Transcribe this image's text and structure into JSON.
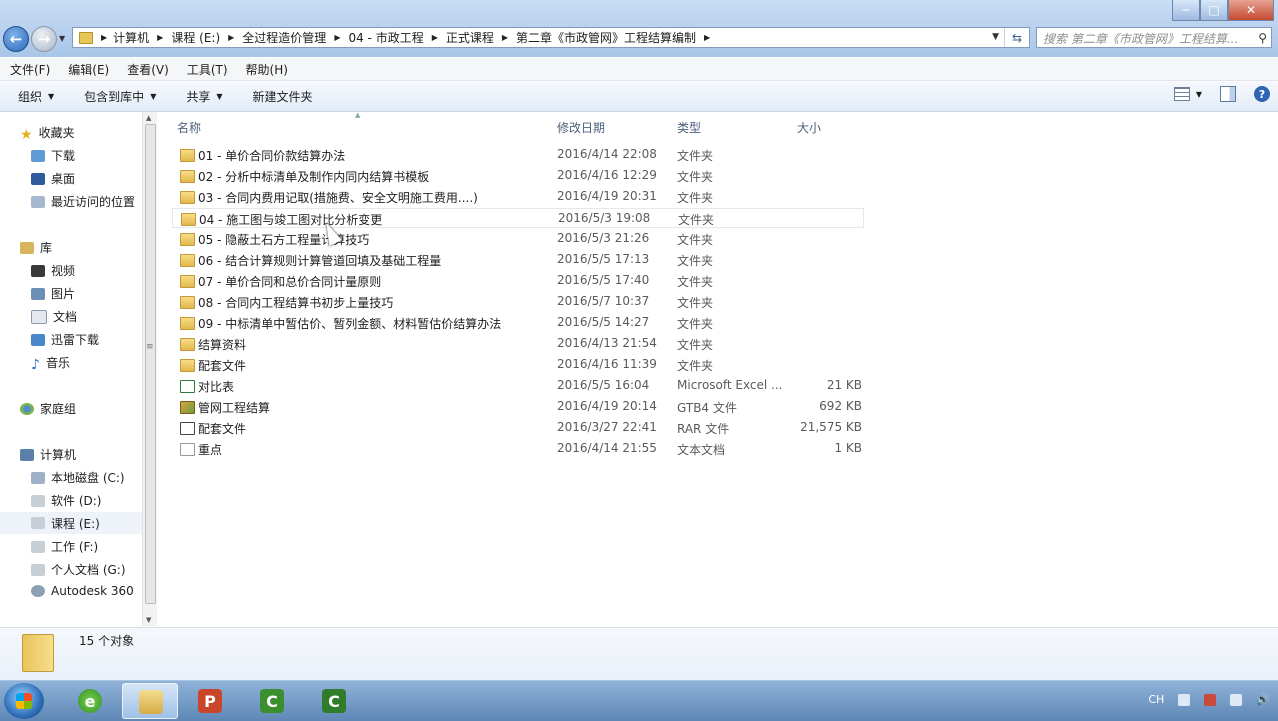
{
  "window": {
    "minimize": "─",
    "maximize": "□",
    "close": "✕"
  },
  "nav": {
    "back": "←",
    "forward": "→"
  },
  "address": {
    "crumbs": [
      "计算机",
      "课程 (E:)",
      "全过程造价管理",
      "04 - 市政工程",
      "正式课程",
      "第二章《市政管网》工程结算编制"
    ]
  },
  "search": {
    "placeholder": "搜索 第二章《市政管网》工程结算..."
  },
  "menu": [
    "文件(F)",
    "编辑(E)",
    "查看(V)",
    "工具(T)",
    "帮助(H)"
  ],
  "commands": {
    "organize": "组织",
    "include": "包含到库中",
    "share": "共享",
    "new_folder": "新建文件夹",
    "help": "?"
  },
  "sidebar": {
    "favorites": {
      "label": "收藏夹",
      "items": [
        "下载",
        "桌面",
        "最近访问的位置"
      ]
    },
    "libraries": {
      "label": "库",
      "items": [
        "视频",
        "图片",
        "文档",
        "迅雷下载",
        "音乐"
      ]
    },
    "homegroup": {
      "label": "家庭组"
    },
    "computer": {
      "label": "计算机",
      "items": [
        "本地磁盘 (C:)",
        "软件 (D:)",
        "课程 (E:)",
        "工作 (F:)",
        "个人文档 (G:)",
        "Autodesk 360"
      ]
    }
  },
  "columns": {
    "name": "名称",
    "date": "修改日期",
    "type": "类型",
    "size": "大小"
  },
  "files": [
    {
      "name": "01 - 单价合同价款结算办法",
      "date": "2016/4/14 22:08",
      "type": "文件夹",
      "size": "",
      "icon": "folder-icon"
    },
    {
      "name": "02 - 分析中标清单及制作内同内结算书模板",
      "date": "2016/4/16 12:29",
      "type": "文件夹",
      "size": "",
      "icon": "folder-icon"
    },
    {
      "name": "03 - 合同内费用记取(措施费、安全文明施工费用....)",
      "date": "2016/4/19 20:31",
      "type": "文件夹",
      "size": "",
      "icon": "folder-icon"
    },
    {
      "name": "04 - 施工图与竣工图对比分析变更",
      "date": "2016/5/3 19:08",
      "type": "文件夹",
      "size": "",
      "icon": "folder-icon"
    },
    {
      "name": "05 - 隐蔽土石方工程量计算技巧",
      "date": "2016/5/3 21:26",
      "type": "文件夹",
      "size": "",
      "icon": "folder-icon"
    },
    {
      "name": "06 - 结合计算规则计算管道回填及基础工程量",
      "date": "2016/5/5 17:13",
      "type": "文件夹",
      "size": "",
      "icon": "folder-icon"
    },
    {
      "name": "07 - 单价合同和总价合同计量原则",
      "date": "2016/5/5 17:40",
      "type": "文件夹",
      "size": "",
      "icon": "folder-icon"
    },
    {
      "name": "08 - 合同内工程结算书初步上量技巧",
      "date": "2016/5/7 10:37",
      "type": "文件夹",
      "size": "",
      "icon": "folder-icon"
    },
    {
      "name": "09 - 中标清单中暂估价、暂列金额、材料暂估价结算办法",
      "date": "2016/5/5 14:27",
      "type": "文件夹",
      "size": "",
      "icon": "folder-icon"
    },
    {
      "name": "结算资料",
      "date": "2016/4/13 21:54",
      "type": "文件夹",
      "size": "",
      "icon": "folder-icon"
    },
    {
      "name": "配套文件",
      "date": "2016/4/16 11:39",
      "type": "文件夹",
      "size": "",
      "icon": "folder-icon"
    },
    {
      "name": "对比表",
      "date": "2016/5/5 16:04",
      "type": "Microsoft Excel ...",
      "size": "21 KB",
      "icon": "excel-file-icon"
    },
    {
      "name": "管网工程结算",
      "date": "2016/4/19 20:14",
      "type": "GTB4 文件",
      "size": "692 KB",
      "icon": "gtb4-file-icon"
    },
    {
      "name": "配套文件",
      "date": "2016/3/27 22:41",
      "type": "RAR 文件",
      "size": "21,575 KB",
      "icon": "rar-file-icon"
    },
    {
      "name": "重点",
      "date": "2016/4/14 21:55",
      "type": "文本文档",
      "size": "1 KB",
      "icon": "text-file-icon"
    }
  ],
  "status": {
    "count": "15 个对象"
  },
  "tray": {
    "ime": "CH"
  }
}
